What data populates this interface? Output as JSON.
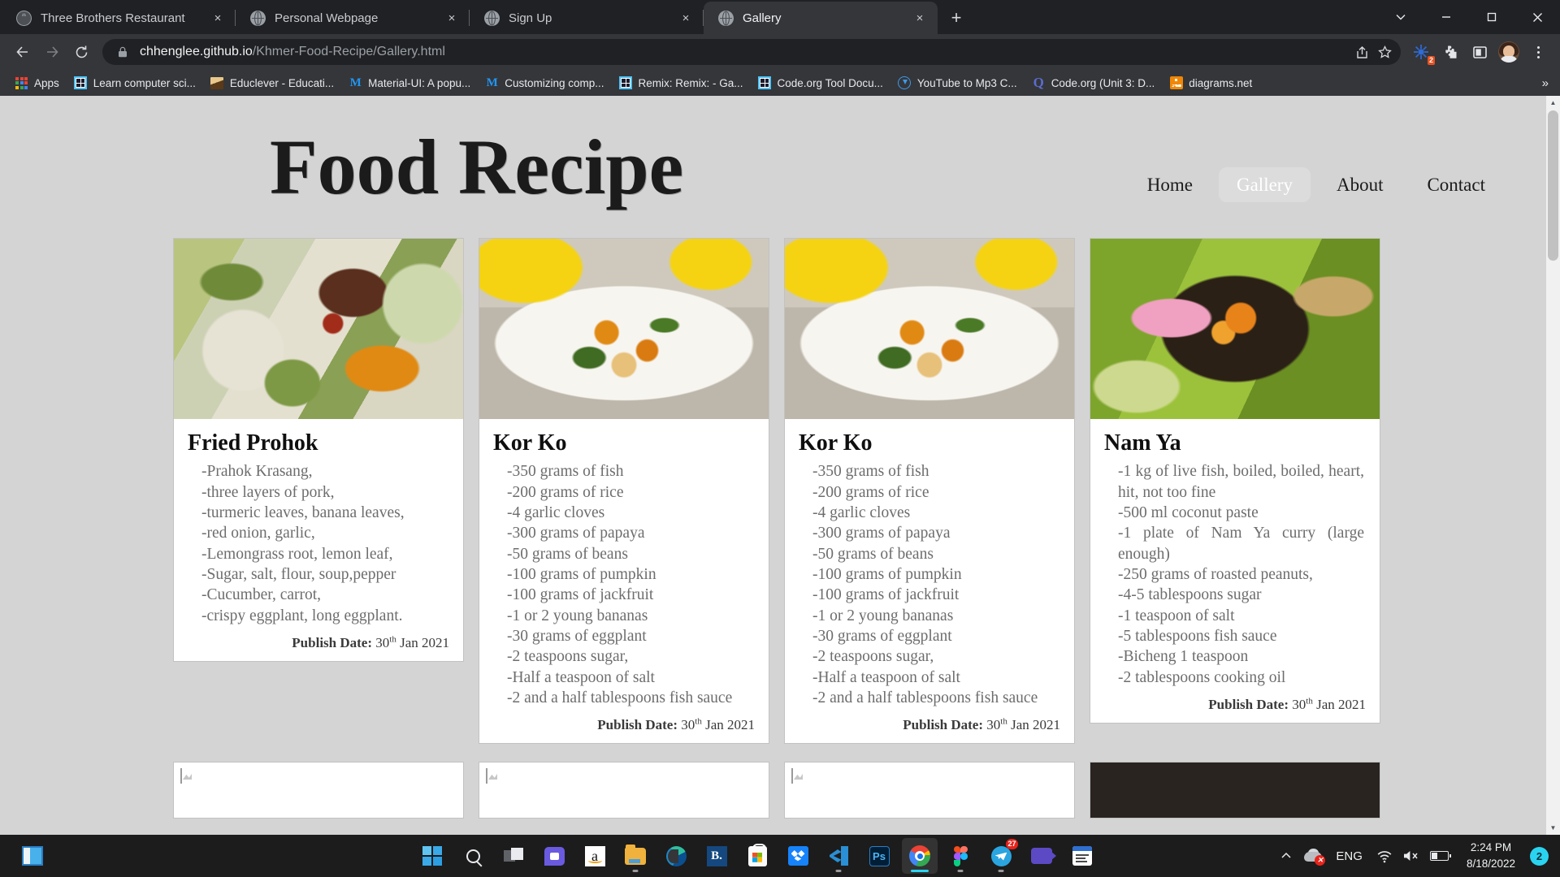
{
  "browser": {
    "tabs": [
      {
        "title": "Three Brothers Restaurant",
        "active": false,
        "close_label": "×"
      },
      {
        "title": "Personal Webpage",
        "active": false,
        "close_label": "×"
      },
      {
        "title": "Sign Up",
        "active": false,
        "close_label": "×"
      },
      {
        "title": "Gallery",
        "active": true,
        "close_label": "×"
      }
    ],
    "new_tab_label": "+",
    "window_controls": [
      "minimize-to-tray-chevron",
      "minimize",
      "maximize",
      "close"
    ],
    "toolbar": {
      "back_icon": "arrow-left-icon",
      "forward_icon": "arrow-right-icon",
      "reload_icon": "reload-icon",
      "lock_icon": "lock-icon",
      "url_host": "chhenglee.github.io",
      "url_path": "/Khmer-Food-Recipe/Gallery.html",
      "share_icon": "share-icon",
      "bookmark_icon": "star-icon",
      "extension_badge_count": "2",
      "profile_icon": "avatar",
      "menu_icon": "three-dots-icon"
    },
    "bookmarks": [
      {
        "label": "Apps",
        "icon": "apps-grid-icon"
      },
      {
        "label": "Learn computer sci...",
        "icon": "code-org-icon"
      },
      {
        "label": "Educlever - Educati...",
        "icon": "book-icon"
      },
      {
        "label": "Material-UI: A popu...",
        "icon": "material-ui-icon"
      },
      {
        "label": "Customizing comp...",
        "icon": "material-ui-icon"
      },
      {
        "label": "Remix: Remix: - Ga...",
        "icon": "code-org-icon"
      },
      {
        "label": "Code.org Tool Docu...",
        "icon": "code-org-icon"
      },
      {
        "label": "YouTube to Mp3 C...",
        "icon": "youtube-converter-icon"
      },
      {
        "label": "Code.org (Unit 3: D...",
        "icon": "quizlet-icon"
      },
      {
        "label": "diagrams.net",
        "icon": "diagrams-net-icon"
      }
    ],
    "bookmarks_overflow_label": "»"
  },
  "page": {
    "site_title": "Food Recipe",
    "nav": [
      {
        "label": "Home",
        "active": false
      },
      {
        "label": "Gallery",
        "active": true
      },
      {
        "label": "About",
        "active": false
      },
      {
        "label": "Contact",
        "active": false
      }
    ],
    "publish_label": "Publish Date:",
    "publish_day": "30",
    "publish_suffix": "th",
    "publish_rest": "Jan 2021",
    "cards": [
      {
        "title": "Fried Prohok",
        "photo": "fried-prohok-photo",
        "justify": false,
        "ingredients": [
          "-Prahok Krasang,",
          "-three layers of pork,",
          "-turmeric leaves, banana leaves,",
          "-red onion, garlic,",
          "-Lemongrass root, lemon leaf,",
          "-Sugar, salt, flour, soup,pepper",
          "-Cucumber, carrot,",
          "-crispy eggplant, long eggplant."
        ]
      },
      {
        "title": "Kor Ko",
        "photo": "kor-ko-photo",
        "justify": false,
        "ingredients": [
          "-350 grams of fish",
          "-200 grams of rice",
          "-4 garlic cloves",
          "-300 grams of papaya",
          "-50 grams of beans",
          "-100 grams of pumpkin",
          "-100 grams of jackfruit",
          "-1 or 2 young bananas",
          "-30 grams of eggplant",
          "-2 teaspoons sugar,",
          "-Half a teaspoon of salt",
          "-2 and a half tablespoons fish sauce"
        ]
      },
      {
        "title": "Kor Ko",
        "photo": "kor-ko-photo",
        "justify": false,
        "ingredients": [
          "-350 grams of fish",
          "-200 grams of rice",
          "-4 garlic cloves",
          "-300 grams of papaya",
          "-50 grams of beans",
          "-100 grams of pumpkin",
          "-100 grams of jackfruit",
          "-1 or 2 young bananas",
          "-30 grams of eggplant",
          "-2 teaspoons sugar,",
          "-Half a teaspoon of salt",
          "-2 and a half tablespoons fish sauce"
        ]
      },
      {
        "title": "Nam Ya",
        "photo": "nam-ya-photo",
        "justify": true,
        "ingredients": [
          "-1 kg of live fish, boiled, boiled, heart, hit, not too fine",
          "-500 ml coconut paste",
          "-1 plate of Nam Ya curry (large enough)",
          "-250 grams of roasted peanuts,",
          "-4-5 tablespoons sugar",
          "-1 teaspoon of salt",
          "-5 tablespoons fish sauce",
          "-Bicheng 1 teaspoon",
          "-2 tablespoons cooking oil"
        ]
      }
    ],
    "next_row_cards": [
      "broken-image-icon",
      "broken-image-icon",
      "broken-image-icon",
      "dark-photo"
    ]
  },
  "scrollbar": {
    "up_arrow": "▲",
    "down_arrow": "▼"
  },
  "taskbar": {
    "start_icon": "windows-start-icon",
    "widgets_icon": "widgets-icon",
    "items": [
      {
        "name": "windows-start-icon",
        "running": false,
        "active": false
      },
      {
        "name": "search-icon",
        "running": false,
        "active": false
      },
      {
        "name": "task-view-icon",
        "running": false,
        "active": false
      },
      {
        "name": "microsoft-teams-icon",
        "running": false,
        "active": false
      },
      {
        "name": "amazon-icon",
        "running": false,
        "active": false
      },
      {
        "name": "file-explorer-icon",
        "running": true,
        "active": false
      },
      {
        "name": "microsoft-edge-icon",
        "running": false,
        "active": false
      },
      {
        "name": "blackboard-icon",
        "running": false,
        "active": false
      },
      {
        "name": "microsoft-store-icon",
        "running": false,
        "active": false
      },
      {
        "name": "dropbox-icon",
        "running": false,
        "active": false
      },
      {
        "name": "vs-code-icon",
        "running": true,
        "active": false
      },
      {
        "name": "photoshop-icon",
        "running": false,
        "active": false
      },
      {
        "name": "google-chrome-icon",
        "running": true,
        "active": true
      },
      {
        "name": "figma-icon",
        "running": true,
        "active": false
      },
      {
        "name": "telegram-icon",
        "running": true,
        "active": false,
        "badge": "27"
      },
      {
        "name": "video-call-icon",
        "running": false,
        "active": false
      },
      {
        "name": "calendar-icon",
        "running": false,
        "active": false
      }
    ],
    "tray": {
      "overflow_icon": "chevron-up-icon",
      "onedrive_icon": "onedrive-error-icon",
      "language": "ENG",
      "wifi_icon": "wifi-icon",
      "volume_icon": "speaker-muted-icon",
      "battery_icon": "battery-icon",
      "time": "2:24 PM",
      "date": "8/18/2022",
      "notification_count": "2"
    }
  },
  "colors": {
    "page_bg": "#d4d4d4",
    "card_bg": "#ffffff",
    "chrome_toolbar": "#35363a",
    "taskbar": "#1c1c1c",
    "accent_cyan": "#2ad4f0",
    "badge_orange": "#e8501e",
    "nav_active_bg": "#dcdcdc"
  }
}
